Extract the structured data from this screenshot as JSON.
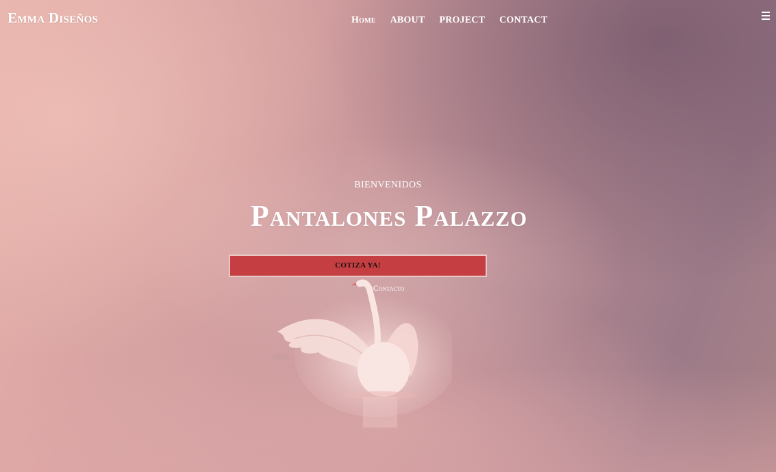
{
  "header": {
    "brand": "Emma Diseños",
    "nav": [
      {
        "label": "Home"
      },
      {
        "label": "ABOUT"
      },
      {
        "label": "PROJECT"
      },
      {
        "label": "CONTACT"
      }
    ],
    "menu_icon": "hamburger-menu-icon"
  },
  "hero": {
    "subtitle": "BIENVENIDOS",
    "title": "Pantalones Palazzo",
    "cta_label": "COTIZA YA!",
    "contact_link": "Contacto",
    "background_image": "pink-misty-lake-swan-photo"
  },
  "colors": {
    "button_bg": "#c43e42",
    "button_border": "#e9c9c6",
    "text": "#ffffff"
  }
}
